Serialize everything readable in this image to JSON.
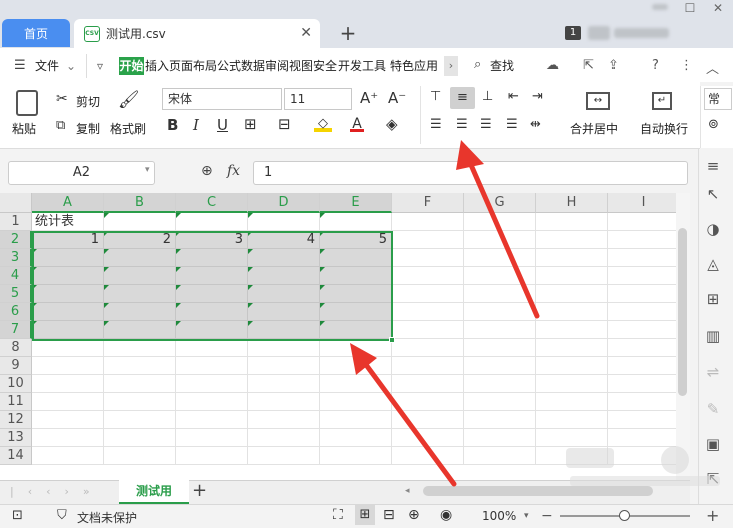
{
  "tabs": {
    "home": "首页",
    "file": "测试用.csv",
    "csv_badge": "CSV",
    "new_tab": "+",
    "page_count": "1"
  },
  "menu": {
    "file": "文件",
    "items": [
      "开始",
      "插入",
      "页面布局",
      "公式",
      "数据",
      "审阅",
      "视图",
      "安全",
      "开发工具",
      "特色应用"
    ],
    "search": "查找"
  },
  "ribbon": {
    "paste": "粘贴",
    "cut": "剪切",
    "copy": "复制",
    "format_painter": "格式刷",
    "font_name": "宋体",
    "font_size": "11",
    "merge_center": "合并居中",
    "wrap_text": "自动换行",
    "number_format_partial": "常"
  },
  "formula_bar": {
    "name_box": "A2",
    "fx": "fx",
    "value": "1"
  },
  "sheet": {
    "columns": [
      "A",
      "B",
      "C",
      "D",
      "E",
      "F",
      "G",
      "H",
      "I"
    ],
    "rows": [
      "1",
      "2",
      "3",
      "4",
      "5",
      "6",
      "7",
      "8",
      "9",
      "10",
      "11",
      "12",
      "13",
      "14"
    ],
    "a1": "统计表",
    "row2_values": [
      "1",
      "2",
      "3",
      "4",
      "5"
    ]
  },
  "sheet_tabs": {
    "active": "测试用",
    "add": "+"
  },
  "status": {
    "doc_protect": "文档未保护",
    "zoom": "100%"
  },
  "colors": {
    "accent_green": "#2a9d4a",
    "tab_blue": "#4a8ef0",
    "arrow_red": "#e8362c",
    "selection_gray": "#d9d9d9"
  }
}
